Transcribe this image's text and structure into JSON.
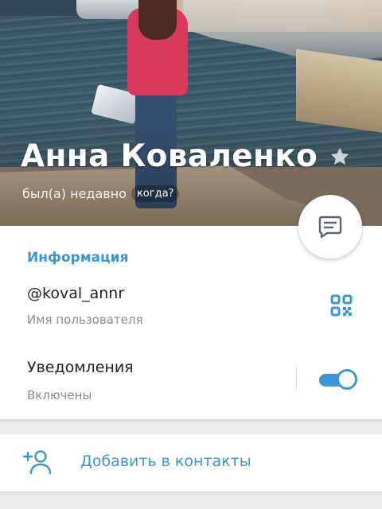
{
  "profile": {
    "name": "Анна Коваленко",
    "status": "был(а) недавно",
    "when_chip": "когда?"
  },
  "info": {
    "section_title": "Информация",
    "username": "@koval_annr",
    "username_caption": "Имя пользователя",
    "notifications_title": "Уведомления",
    "notifications_caption": "Включены",
    "notifications_enabled": true
  },
  "actions": {
    "add_contact_label": "Добавить в контакты"
  },
  "icons": {
    "star": "star-icon",
    "message": "message-icon",
    "qr": "qr-code-icon",
    "add_contact": "add-contact-icon"
  },
  "colors": {
    "accent": "#3d95d3",
    "caption": "#8c8c8c",
    "background": "#ececec"
  }
}
